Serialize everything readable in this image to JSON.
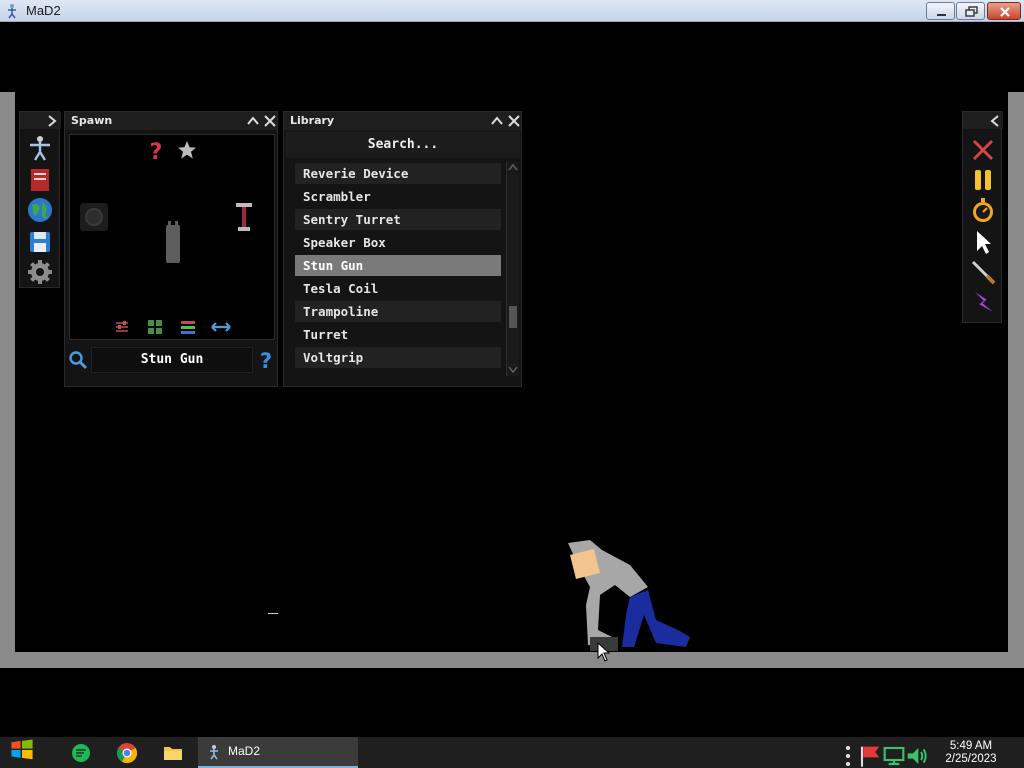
{
  "window": {
    "title": "MaD2"
  },
  "spawn_panel": {
    "title": "Spawn",
    "selected_item": "Stun Gun"
  },
  "library_panel": {
    "title": "Library",
    "search_placeholder": "Search...",
    "items": [
      {
        "label": "Reverie Device",
        "selected": false
      },
      {
        "label": "Scrambler",
        "selected": false
      },
      {
        "label": "Sentry Turret",
        "selected": false
      },
      {
        "label": "Speaker Box",
        "selected": false
      },
      {
        "label": "Stun Gun",
        "selected": true
      },
      {
        "label": "Tesla Coil",
        "selected": false
      },
      {
        "label": "Trampoline",
        "selected": false
      },
      {
        "label": "Turret",
        "selected": false
      },
      {
        "label": "Voltgrip",
        "selected": false
      }
    ],
    "scroll_position": 0.72
  },
  "taskbar": {
    "app_label": "MaD2",
    "time": "5:49 AM",
    "date": "2/25/2023"
  },
  "colors": {
    "wall": "#8a8a8a",
    "panel_bg": "#141414",
    "selection": "#7a7a7a",
    "accent_blue": "#7fb2e5"
  }
}
